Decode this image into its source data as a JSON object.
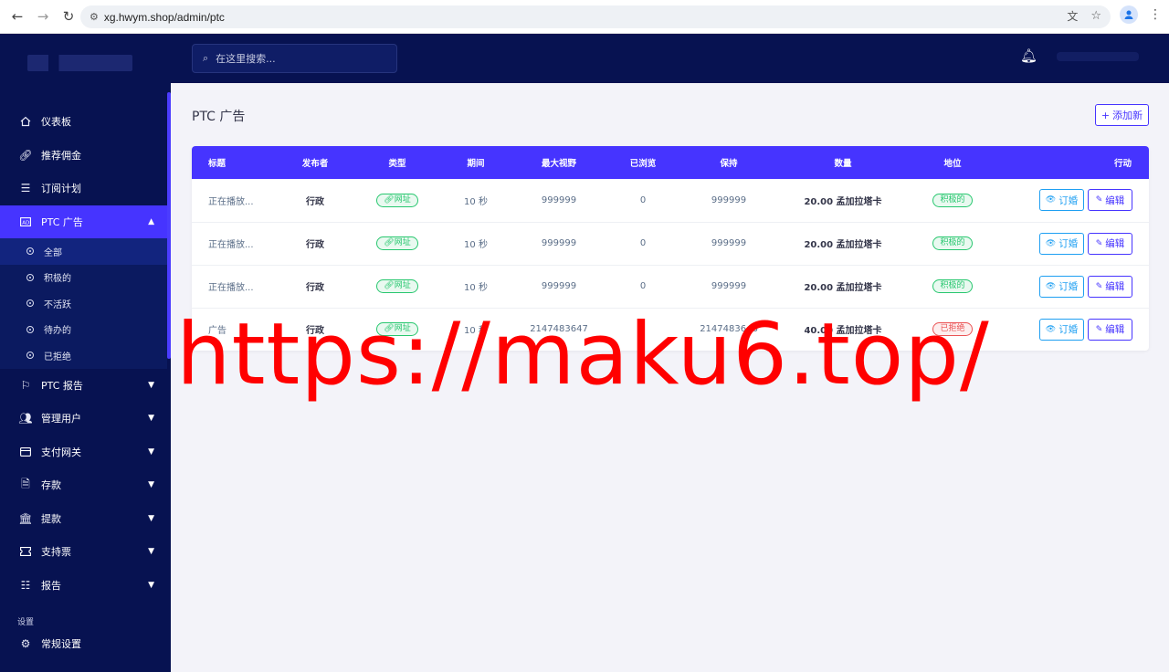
{
  "browser": {
    "url": "xg.hwym.shop/admin/ptc"
  },
  "topbar": {
    "search_placeholder": "在这里搜索..."
  },
  "sidebar": {
    "items": [
      {
        "label": "仪表板",
        "icon": "home-icon"
      },
      {
        "label": "推荐佣金",
        "icon": "link-icon"
      },
      {
        "label": "订阅计划",
        "icon": "menu-icon"
      },
      {
        "label": "PTC 广告",
        "icon": "ad-icon",
        "active": true
      }
    ],
    "submenu": [
      {
        "label": "全部",
        "active": true
      },
      {
        "label": "积极的"
      },
      {
        "label": "不活跃"
      },
      {
        "label": "待办的"
      },
      {
        "label": "已拒绝"
      }
    ],
    "items2": [
      {
        "label": "PTC 报告",
        "icon": "flag-icon"
      },
      {
        "label": "管理用户",
        "icon": "users-icon"
      },
      {
        "label": "支付网关",
        "icon": "card-icon"
      },
      {
        "label": "存款",
        "icon": "deposit-icon"
      },
      {
        "label": "提款",
        "icon": "bank-icon"
      },
      {
        "label": "支持票",
        "icon": "ticket-icon"
      },
      {
        "label": "报告",
        "icon": "list-icon"
      }
    ],
    "section_label": "设置",
    "settings": {
      "label": "常规设置",
      "icon": "gear-icon"
    }
  },
  "main": {
    "title": "PTC 广告",
    "add_button": "添加新",
    "table": {
      "headers": [
        "标题",
        "发布者",
        "类型",
        "期间",
        "最大视野",
        "已浏览",
        "保持",
        "数量",
        "地位",
        "行动"
      ],
      "rows": [
        {
          "title": "正在播放...",
          "publisher": "行政",
          "type": "网址",
          "duration": "10 秒",
          "max_views": "999999",
          "viewed": "0",
          "remain": "999999",
          "amount": "20.00 孟加拉塔卡",
          "status": "积极的",
          "status_color": "green"
        },
        {
          "title": "正在播放...",
          "publisher": "行政",
          "type": "网址",
          "duration": "10 秒",
          "max_views": "999999",
          "viewed": "0",
          "remain": "999999",
          "amount": "20.00 孟加拉塔卡",
          "status": "积极的",
          "status_color": "green"
        },
        {
          "title": "正在播放...",
          "publisher": "行政",
          "type": "网址",
          "duration": "10 秒",
          "max_views": "999999",
          "viewed": "0",
          "remain": "999999",
          "amount": "20.00 孟加拉塔卡",
          "status": "积极的",
          "status_color": "green"
        },
        {
          "title": "广告",
          "publisher": "行政",
          "type": "网址",
          "duration": "10 秒",
          "max_views": "2147483647",
          "viewed": "",
          "remain": "2147483646",
          "amount": "40.00 孟加拉塔卡",
          "status": "已拒绝",
          "status_color": "red"
        }
      ],
      "view_label": "订婚",
      "edit_label": "编辑"
    }
  },
  "watermark": "https://maku6.top/",
  "colors": {
    "primary": "#4634ff",
    "sidebar": "#071251",
    "info": "#1e9ff2",
    "success": "#28c76f",
    "danger": "#ea5455"
  }
}
